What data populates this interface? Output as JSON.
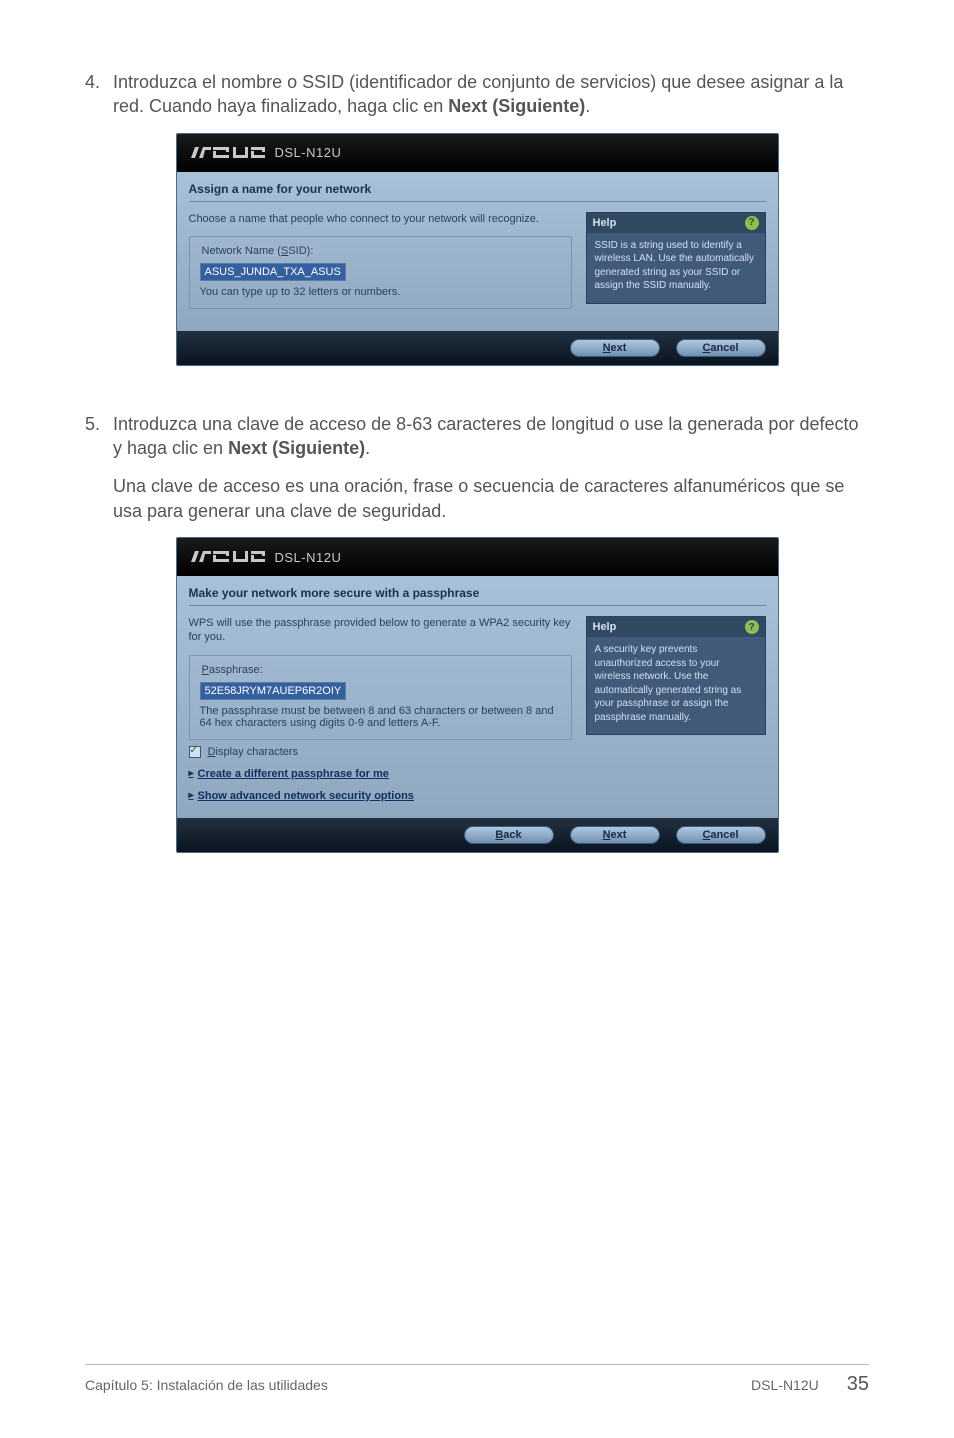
{
  "step4": {
    "num": "4.",
    "text_pre": "Introduzca el nombre o SSID (identificador de conjunto de servicios) que desee asignar a la red. Cuando haya finalizado, haga clic en ",
    "text_bold": "Next (Siguiente)",
    "text_post": "."
  },
  "ss1": {
    "model": "DSL-N12U",
    "title": "Assign a name for your network",
    "desc": "Choose a name that people who connect to your network will recognize.",
    "fieldset_legend_pre": "Network Name (",
    "fieldset_legend_ul": "S",
    "fieldset_legend_post": "SID):",
    "input_value": "ASUS_JUNDA_TXA_ASUS",
    "hint": "You can type up to 32 letters or numbers.",
    "help_title": "Help",
    "help_body": "SSID is a string used to identify a wireless LAN. Use the automatically generated string as your SSID or assign the SSID manually.",
    "btn_next_ul": "N",
    "btn_next_rest": "ext",
    "btn_cancel_ul": "C",
    "btn_cancel_rest": "ancel"
  },
  "step5": {
    "num": "5.",
    "text_pre": "Introduzca una clave de acceso de 8-63 caracteres de longitud o use la generada por defecto y haga clic en ",
    "text_bold": "Next (Siguiente)",
    "text_post": "."
  },
  "sub5": "Una clave de acceso es una oración, frase o secuencia de caracteres alfanuméricos que se usa para generar una clave de seguridad.",
  "ss2": {
    "model": "DSL-N12U",
    "title": "Make your network more secure with a passphrase",
    "desc": "WPS will use the passphrase provided below to generate a WPA2 security key for you.",
    "fieldset_legend_ul": "P",
    "fieldset_legend_rest": "assphrase:",
    "input_value": "52E58JRYM7AUEP6R2OIY",
    "hint": "The passphrase must be between 8 and 63 characters or between 8 and 64 hex characters using digits 0-9 and letters A-F.",
    "chk_ul": "D",
    "chk_rest": "isplay characters",
    "link1": "Create a different passphrase for me",
    "link2": "Show advanced network security options",
    "help_title": "Help",
    "help_body": "A security key prevents unauthorized access to your wireless network. Use the automatically generated string as your passphrase or assign the passphrase manually.",
    "btn_back_ul": "B",
    "btn_back_rest": "ack",
    "btn_next_ul": "N",
    "btn_next_rest": "ext",
    "btn_cancel_ul": "C",
    "btn_cancel_rest": "ancel"
  },
  "footer": {
    "left": "Capítulo 5: Instalación de las utilidades",
    "model": "DSL-N12U",
    "page": "35"
  }
}
